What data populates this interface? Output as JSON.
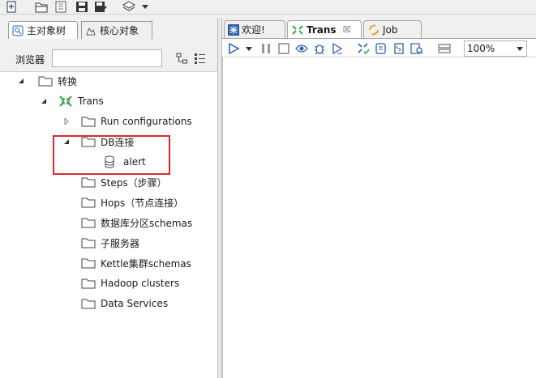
{
  "toolbar": {
    "icons": [
      "new-file-icon",
      "open-folder-icon",
      "explore-repository-icon",
      "save-icon",
      "save-as-icon",
      "layers-icon",
      "dropdown-arrow-icon"
    ]
  },
  "left_panel": {
    "tabs": [
      {
        "label": "主对象树",
        "active": true
      },
      {
        "label": "核心对象",
        "active": false
      }
    ],
    "browser_label": "浏览器",
    "search_value": "",
    "tree": [
      {
        "label": "转换",
        "expanded": true
      },
      {
        "label": "Trans",
        "expanded": true
      },
      {
        "label": "Run configurations",
        "expanded": false
      },
      {
        "label": "DB连接",
        "expanded": true
      },
      {
        "label": "alert"
      },
      {
        "label": "Steps（步骤）"
      },
      {
        "label": "Hops（节点连接）"
      },
      {
        "label": "数据库分区schemas"
      },
      {
        "label": "子服务器"
      },
      {
        "label": "Kettle集群schemas"
      },
      {
        "label": "Hadoop clusters"
      },
      {
        "label": "Data Services"
      }
    ]
  },
  "right_panel": {
    "tabs": [
      {
        "label": "欢迎!",
        "active": false
      },
      {
        "label": "Trans",
        "active": true,
        "close": "☒"
      },
      {
        "label": "Job",
        "active": false
      }
    ],
    "zoom": "100%"
  },
  "colors": {
    "highlight": "#e0262b",
    "trans_green": "#3aa655",
    "job_orange": "#f0a020",
    "tab_blue": "#2a5db0"
  }
}
